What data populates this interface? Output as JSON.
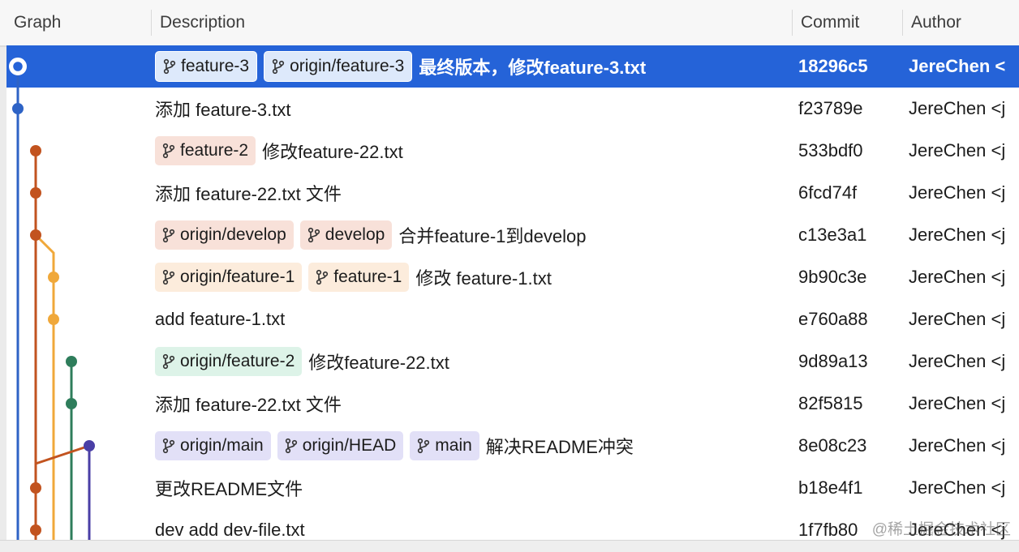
{
  "header": {
    "graph": "Graph",
    "description": "Description",
    "commit": "Commit",
    "author": "Author"
  },
  "commits": [
    {
      "selected": true,
      "branches": [
        {
          "name": "feature-3",
          "color": "#dde9fb"
        },
        {
          "name": "origin/feature-3",
          "color": "#dde9fb"
        }
      ],
      "message": "最终版本，修改feature-3.txt",
      "hash": "18296c5",
      "author": "JereChen <",
      "lane_color": "#2e63c6"
    },
    {
      "branches": [],
      "message": "添加 feature-3.txt",
      "hash": "f23789e",
      "author": "JereChen <j",
      "lane_color": "#2e63c6"
    },
    {
      "branches": [
        {
          "name": "feature-2",
          "color": "#f8e1d9"
        }
      ],
      "message": "修改feature-22.txt",
      "hash": "533bdf0",
      "author": "JereChen <j",
      "lane_color": "#c2531f"
    },
    {
      "branches": [],
      "message": "添加 feature-22.txt 文件",
      "hash": "6fcd74f",
      "author": "JereChen <j",
      "lane_color": "#c2531f"
    },
    {
      "branches": [
        {
          "name": "origin/develop",
          "color": "#f8e1d9"
        },
        {
          "name": "develop",
          "color": "#f8e1d9"
        }
      ],
      "message": "合并feature-1到develop",
      "hash": "c13e3a1",
      "author": "JereChen <j",
      "lane_color": "#c2531f"
    },
    {
      "branches": [
        {
          "name": "origin/feature-1",
          "color": "#fcecdc"
        },
        {
          "name": "feature-1",
          "color": "#fcecdc"
        }
      ],
      "message": "修改 feature-1.txt",
      "hash": "9b90c3e",
      "author": "JereChen <j",
      "lane_color": "#f0a83a"
    },
    {
      "branches": [],
      "message": "add feature-1.txt",
      "hash": "e760a88",
      "author": "JereChen <j",
      "lane_color": "#f0a83a"
    },
    {
      "branches": [
        {
          "name": "origin/feature-2",
          "color": "#ddf3e8"
        }
      ],
      "message": "修改feature-22.txt",
      "hash": "9d89a13",
      "author": "JereChen <j",
      "lane_color": "#2e7d5b"
    },
    {
      "branches": [],
      "message": "添加 feature-22.txt 文件",
      "hash": "82f5815",
      "author": "JereChen <j",
      "lane_color": "#2e7d5b"
    },
    {
      "branches": [
        {
          "name": "origin/main",
          "color": "#e2e0f7"
        },
        {
          "name": "origin/HEAD",
          "color": "#e2e0f7"
        },
        {
          "name": "main",
          "color": "#e2e0f7"
        }
      ],
      "message": "解决README冲突",
      "hash": "8e08c23",
      "author": "JereChen <j",
      "lane_color": "#4a3fa6"
    },
    {
      "branches": [],
      "message": "更改README文件",
      "hash": "b18e4f1",
      "author": "JereChen <j",
      "lane_color": "#c2531f"
    },
    {
      "branches": [],
      "message": "dev add dev-file.txt",
      "hash": "1f7fb80",
      "author": "JereChen <j",
      "lane_color": "#c2531f"
    }
  ],
  "watermark": "@稀土掘金技术社区",
  "icons": {
    "branch": "branch-icon"
  }
}
